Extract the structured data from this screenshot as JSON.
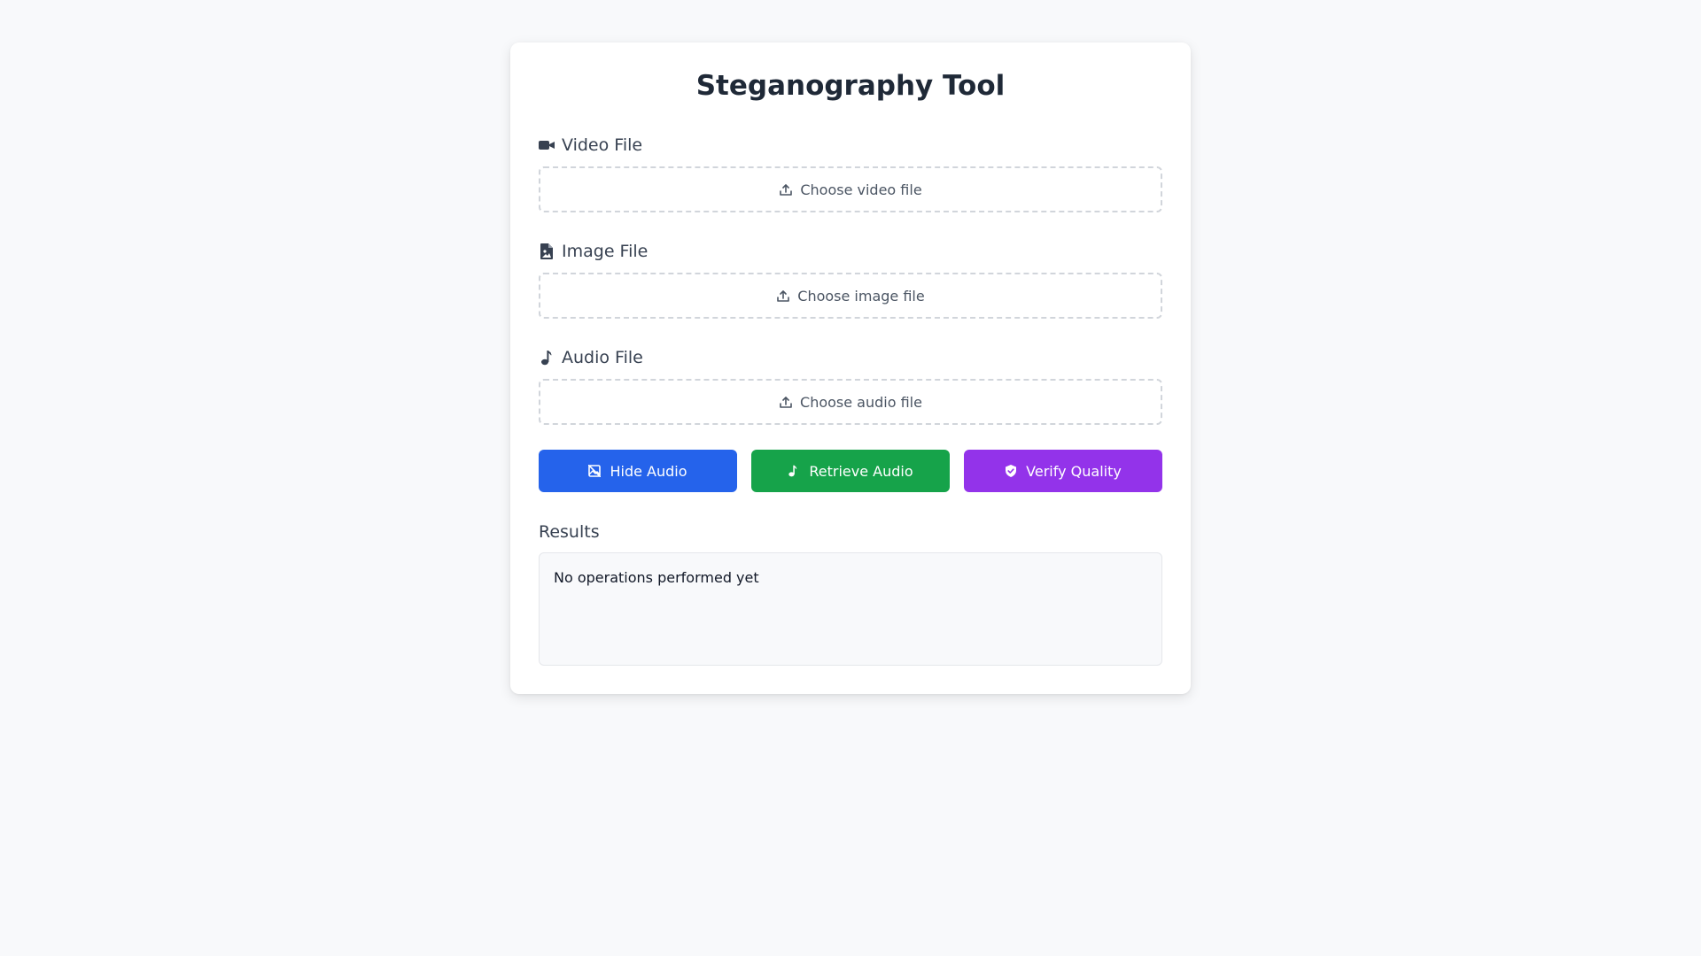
{
  "title": "Steganography Tool",
  "fields": [
    {
      "label": "Video File",
      "icon": "video-camera-icon",
      "placeholder": "Choose video file"
    },
    {
      "label": "Image File",
      "icon": "file-image-icon",
      "placeholder": "Choose image file"
    },
    {
      "label": "Audio File",
      "icon": "music-note-icon",
      "placeholder": "Choose audio file"
    }
  ],
  "buttons": {
    "hide": {
      "label": "Hide Audio",
      "icon": "image-off-icon",
      "color": "#2563eb"
    },
    "retrieve": {
      "label": "Retrieve Audio",
      "icon": "music-note-icon",
      "color": "#16a34a"
    },
    "verify": {
      "label": "Verify Quality",
      "icon": "shield-check-icon",
      "color": "#9333ea"
    }
  },
  "results": {
    "label": "Results",
    "text": "No operations performed yet"
  }
}
